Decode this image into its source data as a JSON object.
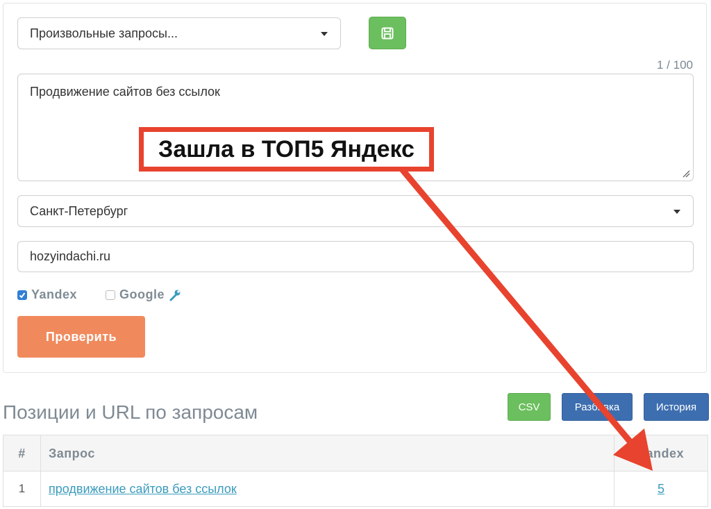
{
  "form": {
    "query_type_select": "Произвольные запросы...",
    "counter": "1 / 100",
    "queries_text": "Продвижение сайтов без ссылок",
    "region_select": "Санкт-Петербург",
    "domain_value": "hozyindachi.ru",
    "engines": [
      {
        "label": "Yandex",
        "checked": true
      },
      {
        "label": "Google",
        "checked": false
      }
    ],
    "check_button": "Проверить"
  },
  "results": {
    "title": "Позиции и URL по запросам",
    "buttons": {
      "csv": "CSV",
      "split": "Разбивка",
      "history": "История"
    },
    "columns": [
      "#",
      "Запрос",
      "Yandex"
    ],
    "rows": [
      {
        "num": "1",
        "query": "продвижение сайтов без ссылок",
        "yandex": "5"
      }
    ]
  },
  "annotation": {
    "callout_text": "Зашла в ТОП5 Яндекс",
    "color": "#e8432e"
  },
  "colors": {
    "save_button": "#6cbf5e",
    "check_button": "#f08a5d",
    "csv_button": "#6cbf5e",
    "blue_button": "#3d6eb0",
    "link": "#3a9bbd"
  }
}
